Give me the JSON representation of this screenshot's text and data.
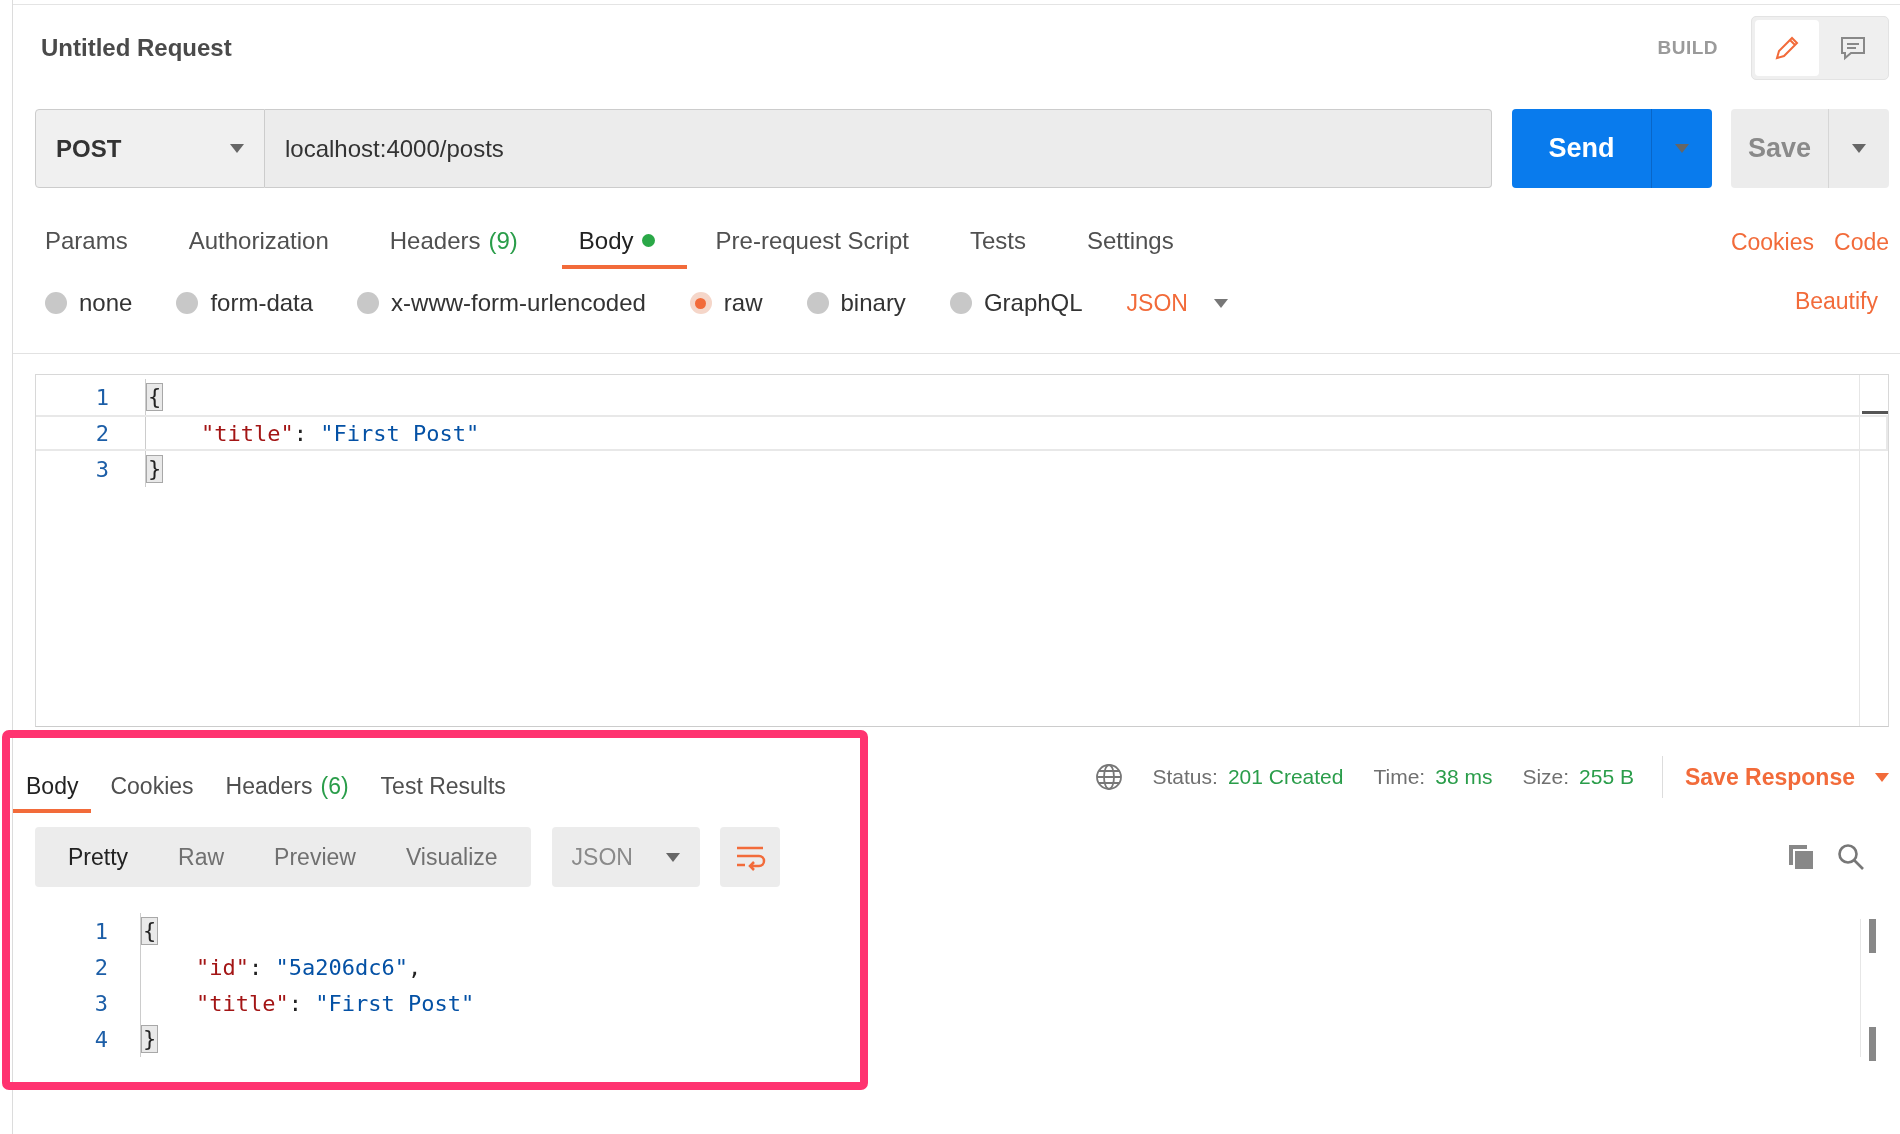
{
  "request": {
    "title": "Untitled Request",
    "mode_label": "BUILD",
    "modes": [
      {
        "kind": "edit",
        "selected": true
      },
      {
        "kind": "comments",
        "selected": false
      }
    ]
  },
  "url_bar": {
    "method": "POST",
    "url": "localhost:4000/posts",
    "send_label": "Send",
    "save_label": "Save"
  },
  "request_tabs": [
    {
      "label": "Params",
      "selected": false
    },
    {
      "label": "Authorization",
      "selected": false
    },
    {
      "label": "Headers",
      "count": "(9)",
      "selected": false
    },
    {
      "label": "Body",
      "selected": true,
      "modified": true
    },
    {
      "label": "Pre-request Script",
      "selected": false
    },
    {
      "label": "Tests",
      "selected": false
    },
    {
      "label": "Settings",
      "selected": false
    }
  ],
  "request_links": [
    "Cookies",
    "Code"
  ],
  "body_types": [
    {
      "label": "none",
      "selected": false
    },
    {
      "label": "form-data",
      "selected": false
    },
    {
      "label": "x-www-form-urlencoded",
      "selected": false
    },
    {
      "label": "raw",
      "selected": true
    },
    {
      "label": "binary",
      "selected": false
    },
    {
      "label": "GraphQL",
      "selected": false
    }
  ],
  "body_language": "JSON",
  "beautify_label": "Beautify",
  "request_body": [
    {
      "number": "1",
      "kind": "brace",
      "active": false,
      "tokens": [
        {
          "kind": "punct",
          "text": "{"
        }
      ]
    },
    {
      "number": "2",
      "kind": "member",
      "active": true,
      "tokens": [
        {
          "kind": "key",
          "text": "\"title\""
        },
        {
          "kind": "punct",
          "text": ": "
        },
        {
          "kind": "string",
          "text": "\"First Post\""
        }
      ]
    },
    {
      "number": "3",
      "kind": "brace",
      "active": false,
      "tokens": [
        {
          "kind": "punct",
          "text": "}"
        }
      ]
    }
  ],
  "response": {
    "tabs": [
      {
        "label": "Body",
        "selected": true
      },
      {
        "label": "Cookies",
        "selected": false
      },
      {
        "label": "Headers",
        "count": "(6)",
        "selected": false
      },
      {
        "label": "Test Results",
        "selected": false
      }
    ],
    "stats": [
      {
        "label": "Status:",
        "value": "201 Created"
      },
      {
        "label": "Time:",
        "value": "38 ms"
      },
      {
        "label": "Size:",
        "value": "255 B"
      }
    ],
    "save_label": "Save Response",
    "view_modes": [
      {
        "label": "Pretty",
        "selected": true
      },
      {
        "label": "Raw",
        "selected": false
      },
      {
        "label": "Preview",
        "selected": false
      },
      {
        "label": "Visualize",
        "selected": false
      }
    ],
    "format": "JSON",
    "wrap_lines": true,
    "lines": [
      {
        "number": "1",
        "kind": "brace",
        "tokens": [
          {
            "kind": "punct",
            "text": "{"
          }
        ]
      },
      {
        "number": "2",
        "kind": "member",
        "tokens": [
          {
            "kind": "key",
            "text": "\"id\""
          },
          {
            "kind": "punct",
            "text": ": "
          },
          {
            "kind": "string",
            "text": "\"5a206dc6\""
          },
          {
            "kind": "punct",
            "text": ","
          }
        ]
      },
      {
        "number": "3",
        "kind": "member",
        "tokens": [
          {
            "kind": "key",
            "text": "\"title\""
          },
          {
            "kind": "punct",
            "text": ": "
          },
          {
            "kind": "string",
            "text": "\"First Post\""
          }
        ]
      },
      {
        "number": "4",
        "kind": "brace",
        "tokens": [
          {
            "kind": "punct",
            "text": "}"
          }
        ]
      }
    ]
  }
}
